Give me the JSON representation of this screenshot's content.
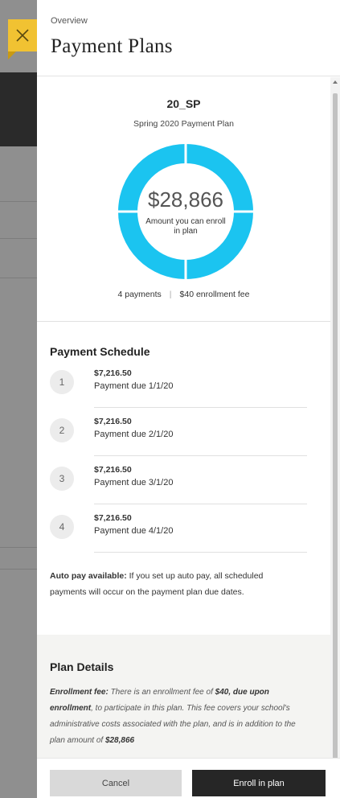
{
  "header": {
    "overview": "Overview",
    "title": "Payment Plans"
  },
  "summary": {
    "plan_code": "20_SP",
    "plan_name": "Spring 2020 Payment Plan",
    "amount": "$28,866",
    "amount_caption": "Amount you can enroll in plan",
    "payments": "4 payments",
    "fee": "$40 enrollment fee"
  },
  "schedule": {
    "title": "Payment Schedule",
    "items": [
      {
        "num": "1",
        "amount": "$7,216.50",
        "due": "Payment due 1/1/20"
      },
      {
        "num": "2",
        "amount": "$7,216.50",
        "due": "Payment due 2/1/20"
      },
      {
        "num": "3",
        "amount": "$7,216.50",
        "due": "Payment due 3/1/20"
      },
      {
        "num": "4",
        "amount": "$7,216.50",
        "due": "Payment due 4/1/20"
      }
    ]
  },
  "autopay": {
    "label": "Auto pay available:",
    "text": " If you set up auto pay, all scheduled payments will occur on the payment plan due dates."
  },
  "details": {
    "title": "Plan Details",
    "fee_label": "Enrollment fee:",
    "text1": " There is an enrollment fee of ",
    "fee_amount": "$40, due upon enrollment",
    "text2": ", to participate in this plan. This fee covers your school's administrative costs associated with the plan, and is in addition to the plan amount of ",
    "plan_amount": "$28,866"
  },
  "footer": {
    "cancel": "Cancel",
    "enroll": "Enroll in plan"
  },
  "colors": {
    "accent": "#1bc4f0",
    "close_button": "#f1c232",
    "primary_button": "#262626"
  },
  "icons": {
    "close": "close-icon"
  }
}
